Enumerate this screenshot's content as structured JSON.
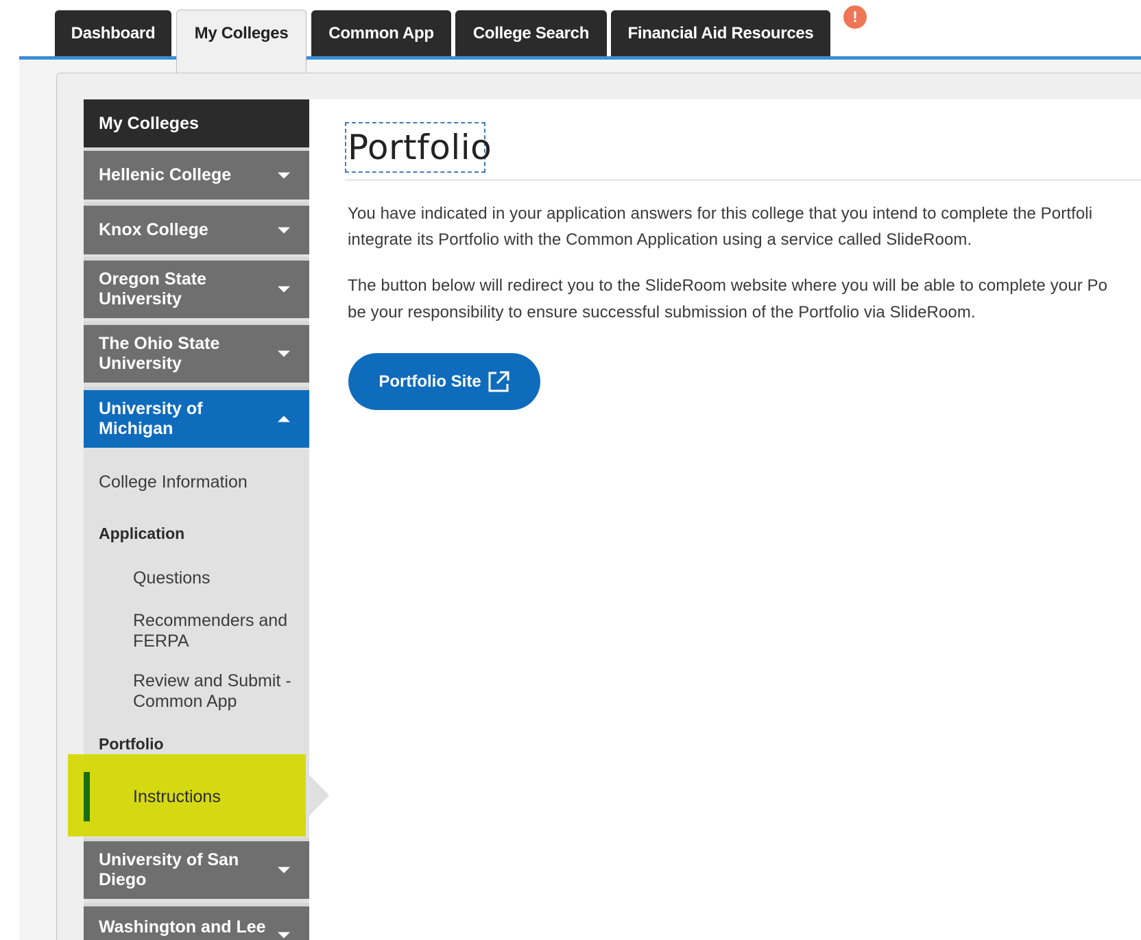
{
  "tabs": [
    {
      "label": "Dashboard"
    },
    {
      "label": "My Colleges"
    },
    {
      "label": "Common App"
    },
    {
      "label": "College Search"
    },
    {
      "label": "Financial Aid Resources"
    }
  ],
  "alert_badge": "!",
  "sidebar": {
    "header": "My Colleges",
    "colleges": [
      {
        "name": "Hellenic College"
      },
      {
        "name": "Knox College"
      },
      {
        "name": "Oregon State University"
      },
      {
        "name": "The Ohio State University"
      },
      {
        "name": "University of Michigan"
      },
      {
        "name": "University of San Diego"
      },
      {
        "name": "Washington and Lee"
      }
    ],
    "college_information": "College Information",
    "application_section": "Application",
    "application_items": [
      "Questions",
      "Recommenders and FERPA",
      "Review and Submit - Common App"
    ],
    "portfolio_section": "Portfolio",
    "portfolio_items": [
      "Instructions"
    ]
  },
  "main": {
    "title": "Portfolio",
    "paragraph1_line1": "You have indicated in your application answers for this college that you intend to complete the Portfoli",
    "paragraph1_line2": "integrate its Portfolio with the Common Application using a service called SlideRoom.",
    "paragraph2_line1": "The button below will redirect you to the SlideRoom website where you will be able to complete your Po",
    "paragraph2_line2": "be your responsibility to ensure successful submission of the Portfolio via SlideRoom.",
    "button_label": "Portfolio Site",
    "button_icon": "external-link-icon"
  },
  "colors": {
    "tab_dark": "#2b2b2b",
    "accent_blue": "#0f6cbd",
    "sidebar_gray": "#6f6f6f",
    "highlight_yellow": "#d4d800",
    "alert_orange": "#ee7657"
  }
}
